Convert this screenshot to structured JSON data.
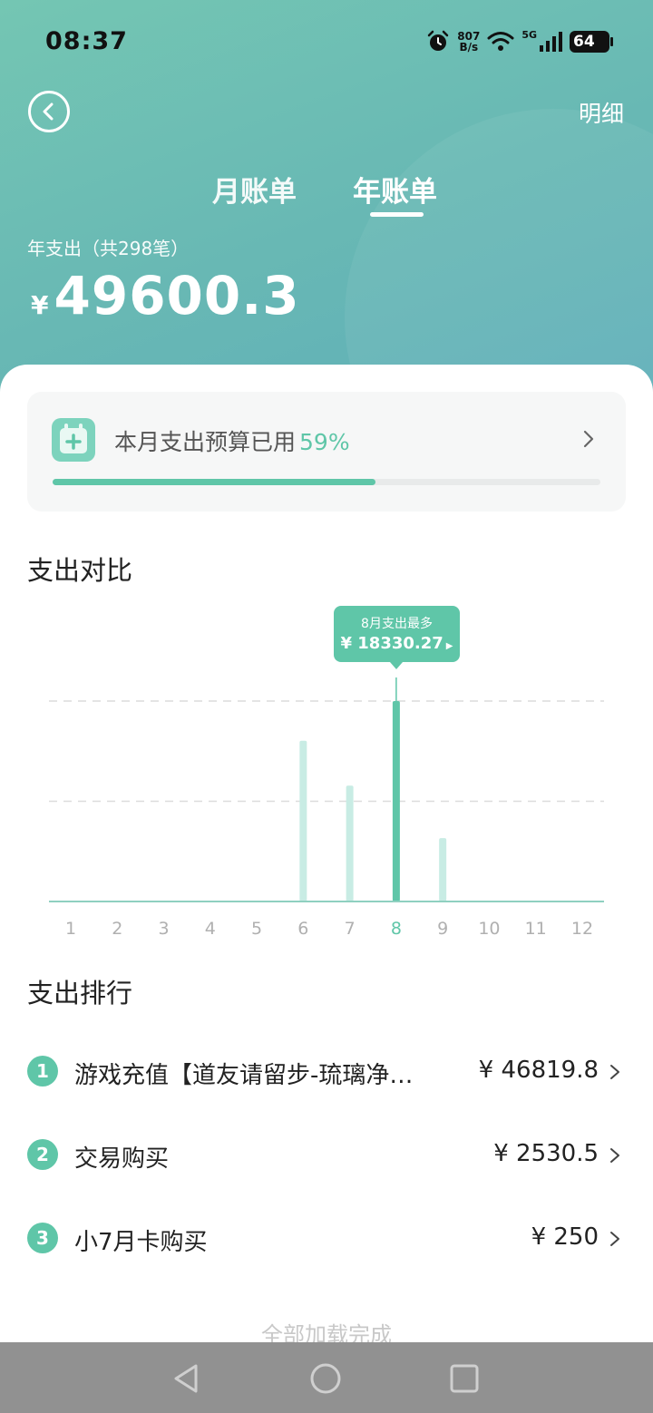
{
  "status_bar": {
    "time": "08:37",
    "net_speed_top": "807",
    "net_speed_bottom": "B/s",
    "network": "5G",
    "battery": "64",
    "icons": [
      "alarm-icon",
      "wifi-icon",
      "signal-icon",
      "battery-icon"
    ]
  },
  "header": {
    "back_icon": "back-circle-icon",
    "detail_link": "明细",
    "tabs": [
      {
        "label": "月账单",
        "active": false
      },
      {
        "label": "年账单",
        "active": true
      }
    ],
    "year_label": "年支出（共298笔）",
    "currency": "¥",
    "year_amount": "49600.3"
  },
  "budget": {
    "icon": "calendar-add-icon",
    "label": "本月支出预算已用",
    "percent_text": "59%",
    "percent": 0.59
  },
  "compare": {
    "title": "支出对比",
    "tooltip_label": "8月支出最多",
    "tooltip_value": "¥ 18330.27"
  },
  "chart_data": {
    "type": "bar",
    "categories": [
      "1",
      "2",
      "3",
      "4",
      "5",
      "6",
      "7",
      "8",
      "9",
      "10",
      "11",
      "12"
    ],
    "values": [
      0,
      0,
      0,
      0,
      0,
      14700,
      10600,
      18330.27,
      5800,
      0,
      0,
      0
    ],
    "highlight_index": 7,
    "ylim": [
      0,
      18330.27
    ],
    "grid": "dashed",
    "colors": {
      "bar": "#c8ece4",
      "highlight": "#5fc6a8",
      "axis": "#8fd0c0",
      "tick": "#b0b0b0",
      "tick_active": "#5fc6a8"
    }
  },
  "ranking": {
    "title": "支出排行",
    "items": [
      {
        "rank": "1",
        "name": "游戏充值【道友请留步-琉璃净…",
        "amount": "¥ 46819.8"
      },
      {
        "rank": "2",
        "name": "交易购买",
        "amount": "¥ 2530.5"
      },
      {
        "rank": "3",
        "name": "小7月卡购买",
        "amount": "¥ 250"
      }
    ]
  },
  "footer_text": "全部加载完成",
  "nav": {
    "icons": [
      "back-triangle-icon",
      "home-circle-icon",
      "recents-square-icon"
    ]
  },
  "colors": {
    "accent": "#5fc6a8",
    "header_start": "#74c6b3",
    "header_end": "#5fafb9"
  }
}
